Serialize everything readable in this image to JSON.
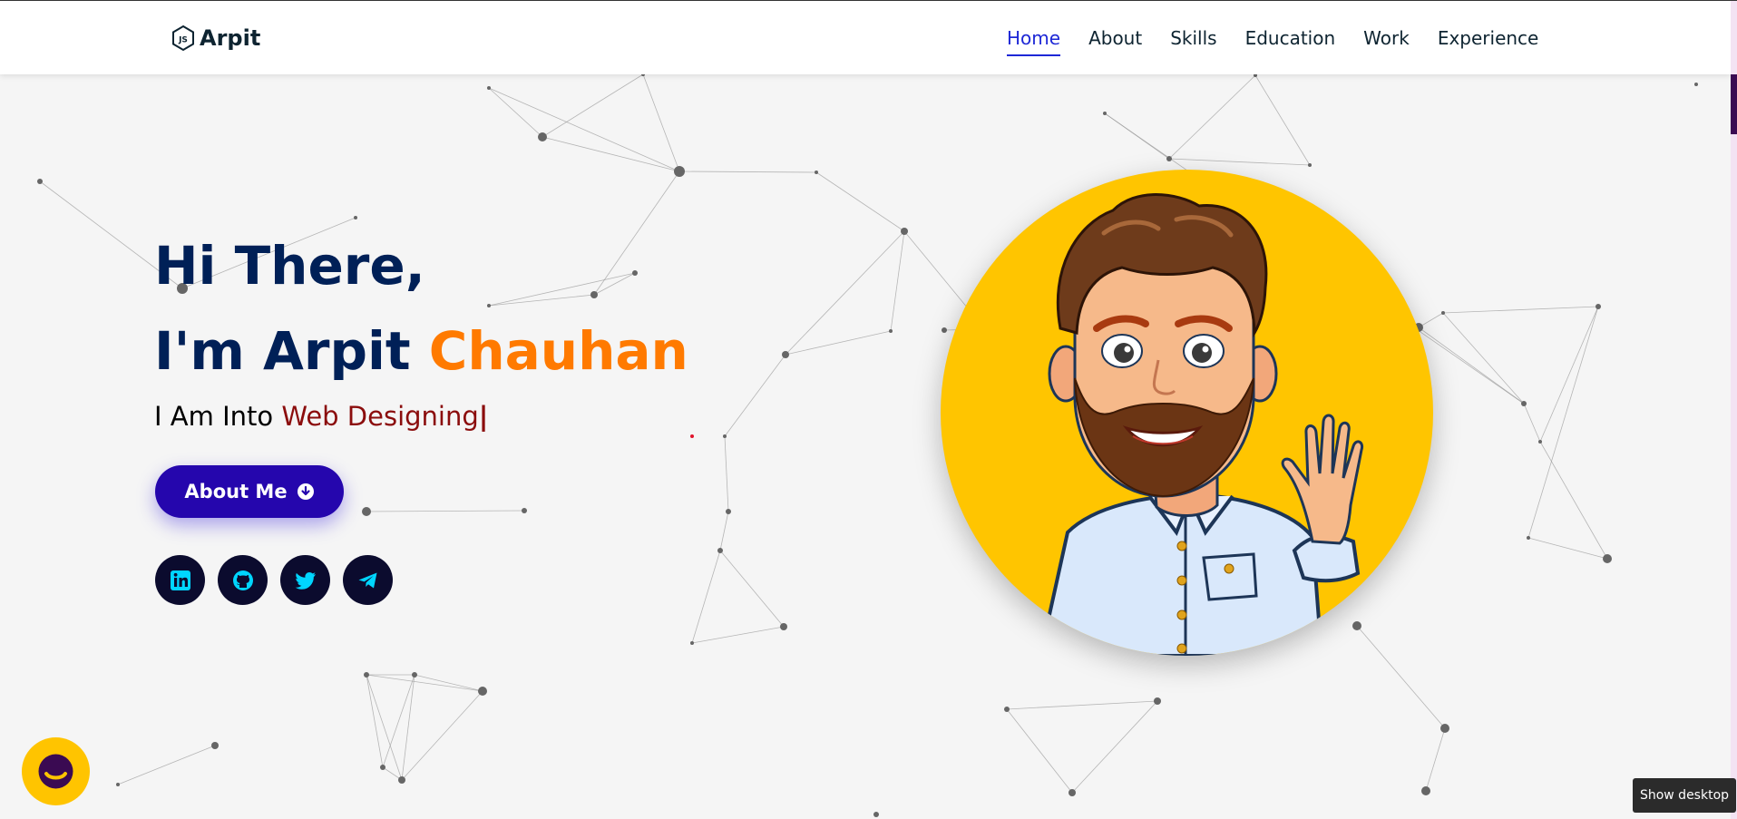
{
  "brand": {
    "name": "Arpit",
    "icon": "nodejs-hexagon-icon"
  },
  "nav": {
    "items": [
      {
        "label": "Home",
        "active": true
      },
      {
        "label": "About",
        "active": false
      },
      {
        "label": "Skills",
        "active": false
      },
      {
        "label": "Education",
        "active": false
      },
      {
        "label": "Work",
        "active": false
      },
      {
        "label": "Experience",
        "active": false
      }
    ]
  },
  "hero": {
    "greeting": "Hi There,",
    "intro_prefix": "I'm Arpit ",
    "intro_highlight": "Chauhan",
    "into_prefix": "I Am Into ",
    "typed_text": "Web Designing",
    "caret": "|",
    "about_button_label": "About Me",
    "about_button_icon": "arrow-circle-down-icon"
  },
  "socials": [
    {
      "name": "linkedin",
      "icon": "linkedin-icon"
    },
    {
      "name": "github",
      "icon": "github-icon"
    },
    {
      "name": "twitter",
      "icon": "twitter-icon"
    },
    {
      "name": "telegram",
      "icon": "telegram-icon"
    }
  ],
  "avatar": {
    "alt": "cartoon avatar waving"
  },
  "chat": {
    "icon": "chat-face-icon"
  },
  "tooltip": {
    "label": "Show desktop"
  },
  "colors": {
    "accent": "#1d27d6",
    "heading": "#002057",
    "highlight": "#ff7a00",
    "typed": "#8b0d0d",
    "button": "#2506ad",
    "avatar_bg": "#ffc500",
    "social_bg": "#0b0b2e",
    "social_icon": "#00d5ff"
  }
}
